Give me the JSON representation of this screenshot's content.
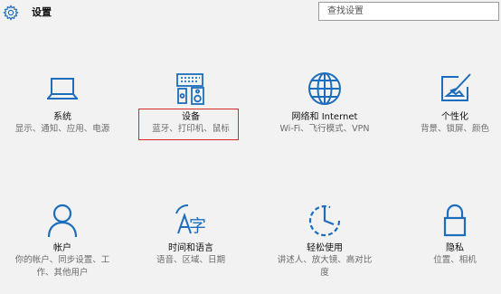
{
  "header": {
    "title": "设置",
    "search_placeholder": "查找设置"
  },
  "tiles": [
    {
      "name": "系统",
      "desc": "显示、通知、应用、电源",
      "icon": "laptop-icon"
    },
    {
      "name": "设备",
      "desc": "蓝牙、打印机、鼠标",
      "icon": "devices-icon",
      "highlighted": true
    },
    {
      "name": "网络和 Internet",
      "desc": "Wi-Fi、飞行模式、VPN",
      "icon": "globe-icon"
    },
    {
      "name": "个性化",
      "desc": "背景、锁屏、颜色",
      "icon": "paint-icon"
    },
    {
      "name": "帐户",
      "desc": "你的帐户、同步设置、工作、其他用户",
      "icon": "person-icon"
    },
    {
      "name": "时间和语言",
      "desc": "语音、区域、日期",
      "icon": "time-language-icon"
    },
    {
      "name": "轻松使用",
      "desc": "讲述人、放大镜、高对比度",
      "icon": "ease-of-access-icon"
    },
    {
      "name": "隐私",
      "desc": "位置、相机",
      "icon": "lock-icon"
    }
  ],
  "colors": {
    "accent": "#1c6dbd",
    "highlight_border": "#d9262b",
    "background": "#f2f2f2"
  }
}
